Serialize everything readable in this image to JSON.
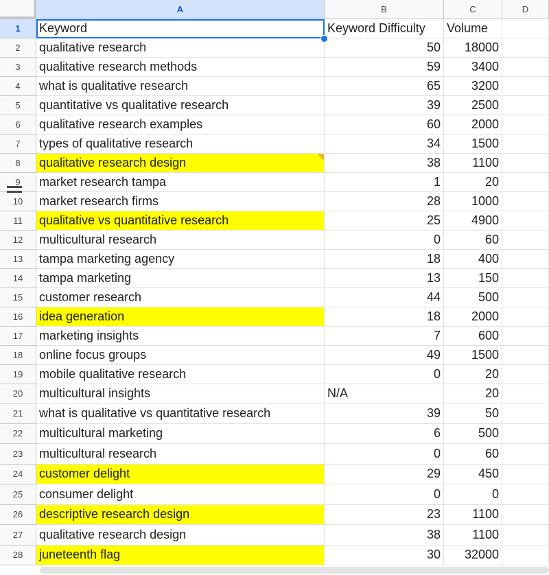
{
  "columns": [
    "A",
    "B",
    "C",
    "D"
  ],
  "rows": [
    {
      "num": "1",
      "a": "Keyword",
      "b": "Keyword Difficulty",
      "c": "Volume",
      "hl": false,
      "bAlign": "left",
      "cAlign": "left"
    },
    {
      "num": "2",
      "a": "qualitative research",
      "b": "50",
      "c": "18000",
      "hl": false
    },
    {
      "num": "3",
      "a": "qualitative research methods",
      "b": "59",
      "c": "3400",
      "hl": false
    },
    {
      "num": "4",
      "a": "what is qualitative research",
      "b": "65",
      "c": "3200",
      "hl": false
    },
    {
      "num": "5",
      "a": "quantitative vs qualitative research",
      "b": "39",
      "c": "2500",
      "hl": false
    },
    {
      "num": "6",
      "a": "qualitative research examples",
      "b": "60",
      "c": "2000",
      "hl": false
    },
    {
      "num": "7",
      "a": "types of qualitative research",
      "b": "34",
      "c": "1500",
      "hl": false
    },
    {
      "num": "8",
      "a": "qualitative research design",
      "b": "38",
      "c": "1100",
      "hl": true,
      "note": true
    },
    {
      "num": "9",
      "a": "market research tampa",
      "b": "1",
      "c": "20",
      "hl": false
    },
    {
      "num": "10",
      "a": "market research firms",
      "b": "28",
      "c": "1000",
      "hl": false
    },
    {
      "num": "11",
      "a": "qualitative vs quantitative research",
      "b": "25",
      "c": "4900",
      "hl": true
    },
    {
      "num": "12",
      "a": "multicultural research",
      "b": "0",
      "c": "60",
      "hl": false
    },
    {
      "num": "13",
      "a": "tampa marketing agency",
      "b": "18",
      "c": "400",
      "hl": false
    },
    {
      "num": "14",
      "a": "tampa marketing",
      "b": "13",
      "c": "150",
      "hl": false
    },
    {
      "num": "15",
      "a": "customer research",
      "b": "44",
      "c": "500",
      "hl": false
    },
    {
      "num": "16",
      "a": "idea generation",
      "b": "18",
      "c": "2000",
      "hl": true
    },
    {
      "num": "17",
      "a": "marketing insights",
      "b": "7",
      "c": "600",
      "hl": false
    },
    {
      "num": "18",
      "a": "online focus groups",
      "b": "49",
      "c": "1500",
      "hl": false
    },
    {
      "num": "19",
      "a": "mobile qualitative research",
      "b": "0",
      "c": "20",
      "hl": false
    },
    {
      "num": "20",
      "a": "multicultural insights",
      "b": "N/A",
      "c": "20",
      "hl": false,
      "bAlign": "left"
    },
    {
      "num": "21",
      "a": "what is qualitative vs quantitative research",
      "b": "39",
      "c": "50",
      "hl": false
    },
    {
      "num": "22",
      "a": "multicultural marketing",
      "b": "6",
      "c": "500",
      "hl": false
    },
    {
      "num": "23",
      "a": "multicultural research",
      "b": "0",
      "c": "60",
      "hl": false
    },
    {
      "num": "24",
      "a": "customer delight",
      "b": "29",
      "c": "450",
      "hl": true
    },
    {
      "num": "25",
      "a": "consumer delight",
      "b": "0",
      "c": "0",
      "hl": false
    },
    {
      "num": "26",
      "a": "descriptive research design",
      "b": "23",
      "c": "1100",
      "hl": true
    },
    {
      "num": "27",
      "a": "qualitative research design",
      "b": "38",
      "c": "1100",
      "hl": false
    },
    {
      "num": "28",
      "a": "juneteenth flag",
      "b": "30",
      "c": "32000",
      "hl": true
    }
  ],
  "colors": {
    "highlight": "#ffff00",
    "selection": "#1a73e8",
    "note": "#f4a93a"
  }
}
